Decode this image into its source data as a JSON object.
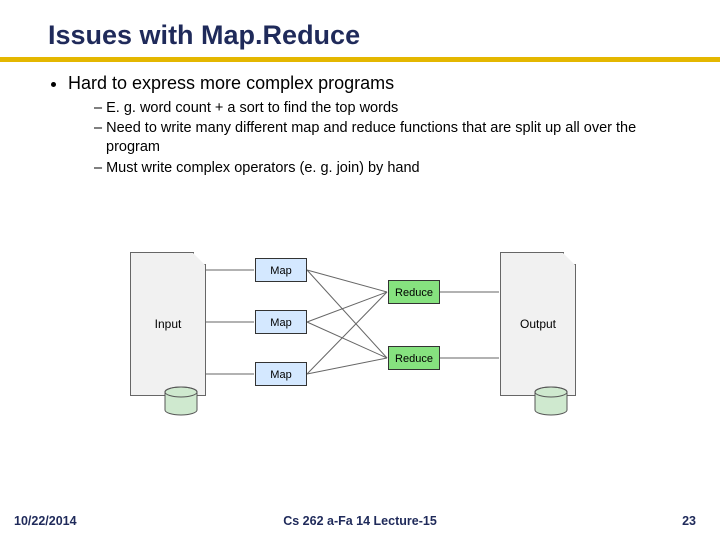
{
  "title": "Issues with Map.Reduce",
  "bullet1": "Hard to express more complex programs",
  "sub1": "E. g. word count + a sort to find the top words",
  "sub2": "Need to write many different map and reduce functions that are split up all over the program",
  "sub3": "Must write complex operators (e. g. join) by hand",
  "diagram": {
    "input": "Input",
    "output": "Output",
    "map": "Map",
    "reduce": "Reduce"
  },
  "footer": {
    "date": "10/22/2014",
    "center": "Cs 262 a-Fa 14 Lecture-15",
    "page": "23"
  }
}
